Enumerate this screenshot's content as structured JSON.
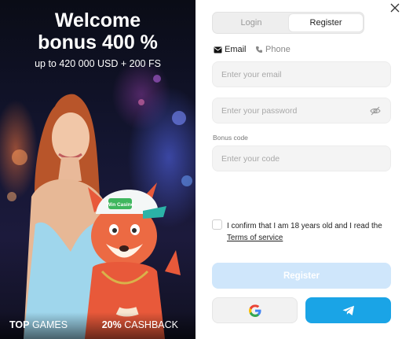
{
  "promo": {
    "title_line1": "Welcome",
    "title_line2": "bonus 400 %",
    "subtitle": "up to 420 000 USD + 200 FS",
    "left_label_bold": "TOP",
    "left_label_rest": " GAMES",
    "right_label_bold": "20%",
    "right_label_rest": " CASHBACK",
    "mascot_cap_text": "Win Casino"
  },
  "tabs": {
    "login": "Login",
    "register": "Register",
    "active": "register"
  },
  "methods": {
    "email": "Email",
    "phone": "Phone",
    "active": "email"
  },
  "form": {
    "email_placeholder": "Enter your email",
    "password_placeholder": "Enter your password",
    "bonus_label": "Bonus code",
    "bonus_placeholder": "Enter your code",
    "confirm_text": "I confirm that I am 18 years old and I read the ",
    "terms_link": "Terms of service",
    "register_label": "Register"
  },
  "colors": {
    "accent": "#1aa4e6",
    "register_disabled": "#cfe6fb",
    "field_bg": "#f4f4f4"
  },
  "icons": [
    "close-icon",
    "email-icon",
    "phone-icon",
    "eye-off-icon",
    "google-icon",
    "telegram-icon"
  ]
}
